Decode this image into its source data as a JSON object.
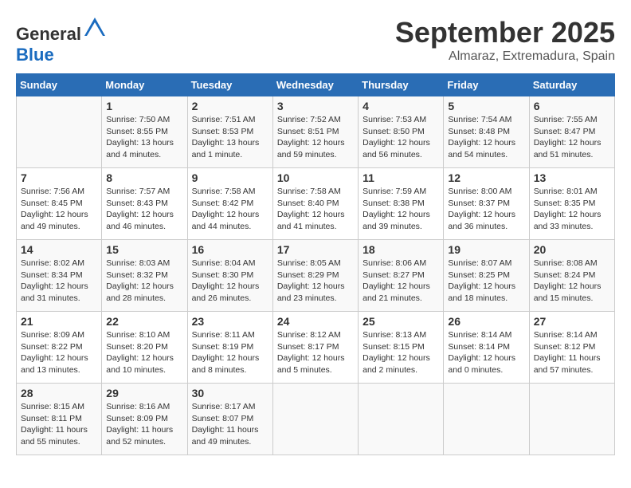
{
  "header": {
    "logo_general": "General",
    "logo_blue": "Blue",
    "month": "September 2025",
    "location": "Almaraz, Extremadura, Spain"
  },
  "days_of_week": [
    "Sunday",
    "Monday",
    "Tuesday",
    "Wednesday",
    "Thursday",
    "Friday",
    "Saturday"
  ],
  "weeks": [
    [
      {
        "day": "",
        "info": ""
      },
      {
        "day": "1",
        "info": "Sunrise: 7:50 AM\nSunset: 8:55 PM\nDaylight: 13 hours\nand 4 minutes."
      },
      {
        "day": "2",
        "info": "Sunrise: 7:51 AM\nSunset: 8:53 PM\nDaylight: 13 hours\nand 1 minute."
      },
      {
        "day": "3",
        "info": "Sunrise: 7:52 AM\nSunset: 8:51 PM\nDaylight: 12 hours\nand 59 minutes."
      },
      {
        "day": "4",
        "info": "Sunrise: 7:53 AM\nSunset: 8:50 PM\nDaylight: 12 hours\nand 56 minutes."
      },
      {
        "day": "5",
        "info": "Sunrise: 7:54 AM\nSunset: 8:48 PM\nDaylight: 12 hours\nand 54 minutes."
      },
      {
        "day": "6",
        "info": "Sunrise: 7:55 AM\nSunset: 8:47 PM\nDaylight: 12 hours\nand 51 minutes."
      }
    ],
    [
      {
        "day": "7",
        "info": "Sunrise: 7:56 AM\nSunset: 8:45 PM\nDaylight: 12 hours\nand 49 minutes."
      },
      {
        "day": "8",
        "info": "Sunrise: 7:57 AM\nSunset: 8:43 PM\nDaylight: 12 hours\nand 46 minutes."
      },
      {
        "day": "9",
        "info": "Sunrise: 7:58 AM\nSunset: 8:42 PM\nDaylight: 12 hours\nand 44 minutes."
      },
      {
        "day": "10",
        "info": "Sunrise: 7:58 AM\nSunset: 8:40 PM\nDaylight: 12 hours\nand 41 minutes."
      },
      {
        "day": "11",
        "info": "Sunrise: 7:59 AM\nSunset: 8:38 PM\nDaylight: 12 hours\nand 39 minutes."
      },
      {
        "day": "12",
        "info": "Sunrise: 8:00 AM\nSunset: 8:37 PM\nDaylight: 12 hours\nand 36 minutes."
      },
      {
        "day": "13",
        "info": "Sunrise: 8:01 AM\nSunset: 8:35 PM\nDaylight: 12 hours\nand 33 minutes."
      }
    ],
    [
      {
        "day": "14",
        "info": "Sunrise: 8:02 AM\nSunset: 8:34 PM\nDaylight: 12 hours\nand 31 minutes."
      },
      {
        "day": "15",
        "info": "Sunrise: 8:03 AM\nSunset: 8:32 PM\nDaylight: 12 hours\nand 28 minutes."
      },
      {
        "day": "16",
        "info": "Sunrise: 8:04 AM\nSunset: 8:30 PM\nDaylight: 12 hours\nand 26 minutes."
      },
      {
        "day": "17",
        "info": "Sunrise: 8:05 AM\nSunset: 8:29 PM\nDaylight: 12 hours\nand 23 minutes."
      },
      {
        "day": "18",
        "info": "Sunrise: 8:06 AM\nSunset: 8:27 PM\nDaylight: 12 hours\nand 21 minutes."
      },
      {
        "day": "19",
        "info": "Sunrise: 8:07 AM\nSunset: 8:25 PM\nDaylight: 12 hours\nand 18 minutes."
      },
      {
        "day": "20",
        "info": "Sunrise: 8:08 AM\nSunset: 8:24 PM\nDaylight: 12 hours\nand 15 minutes."
      }
    ],
    [
      {
        "day": "21",
        "info": "Sunrise: 8:09 AM\nSunset: 8:22 PM\nDaylight: 12 hours\nand 13 minutes."
      },
      {
        "day": "22",
        "info": "Sunrise: 8:10 AM\nSunset: 8:20 PM\nDaylight: 12 hours\nand 10 minutes."
      },
      {
        "day": "23",
        "info": "Sunrise: 8:11 AM\nSunset: 8:19 PM\nDaylight: 12 hours\nand 8 minutes."
      },
      {
        "day": "24",
        "info": "Sunrise: 8:12 AM\nSunset: 8:17 PM\nDaylight: 12 hours\nand 5 minutes."
      },
      {
        "day": "25",
        "info": "Sunrise: 8:13 AM\nSunset: 8:15 PM\nDaylight: 12 hours\nand 2 minutes."
      },
      {
        "day": "26",
        "info": "Sunrise: 8:14 AM\nSunset: 8:14 PM\nDaylight: 12 hours\nand 0 minutes."
      },
      {
        "day": "27",
        "info": "Sunrise: 8:14 AM\nSunset: 8:12 PM\nDaylight: 11 hours\nand 57 minutes."
      }
    ],
    [
      {
        "day": "28",
        "info": "Sunrise: 8:15 AM\nSunset: 8:11 PM\nDaylight: 11 hours\nand 55 minutes."
      },
      {
        "day": "29",
        "info": "Sunrise: 8:16 AM\nSunset: 8:09 PM\nDaylight: 11 hours\nand 52 minutes."
      },
      {
        "day": "30",
        "info": "Sunrise: 8:17 AM\nSunset: 8:07 PM\nDaylight: 11 hours\nand 49 minutes."
      },
      {
        "day": "",
        "info": ""
      },
      {
        "day": "",
        "info": ""
      },
      {
        "day": "",
        "info": ""
      },
      {
        "day": "",
        "info": ""
      }
    ]
  ]
}
